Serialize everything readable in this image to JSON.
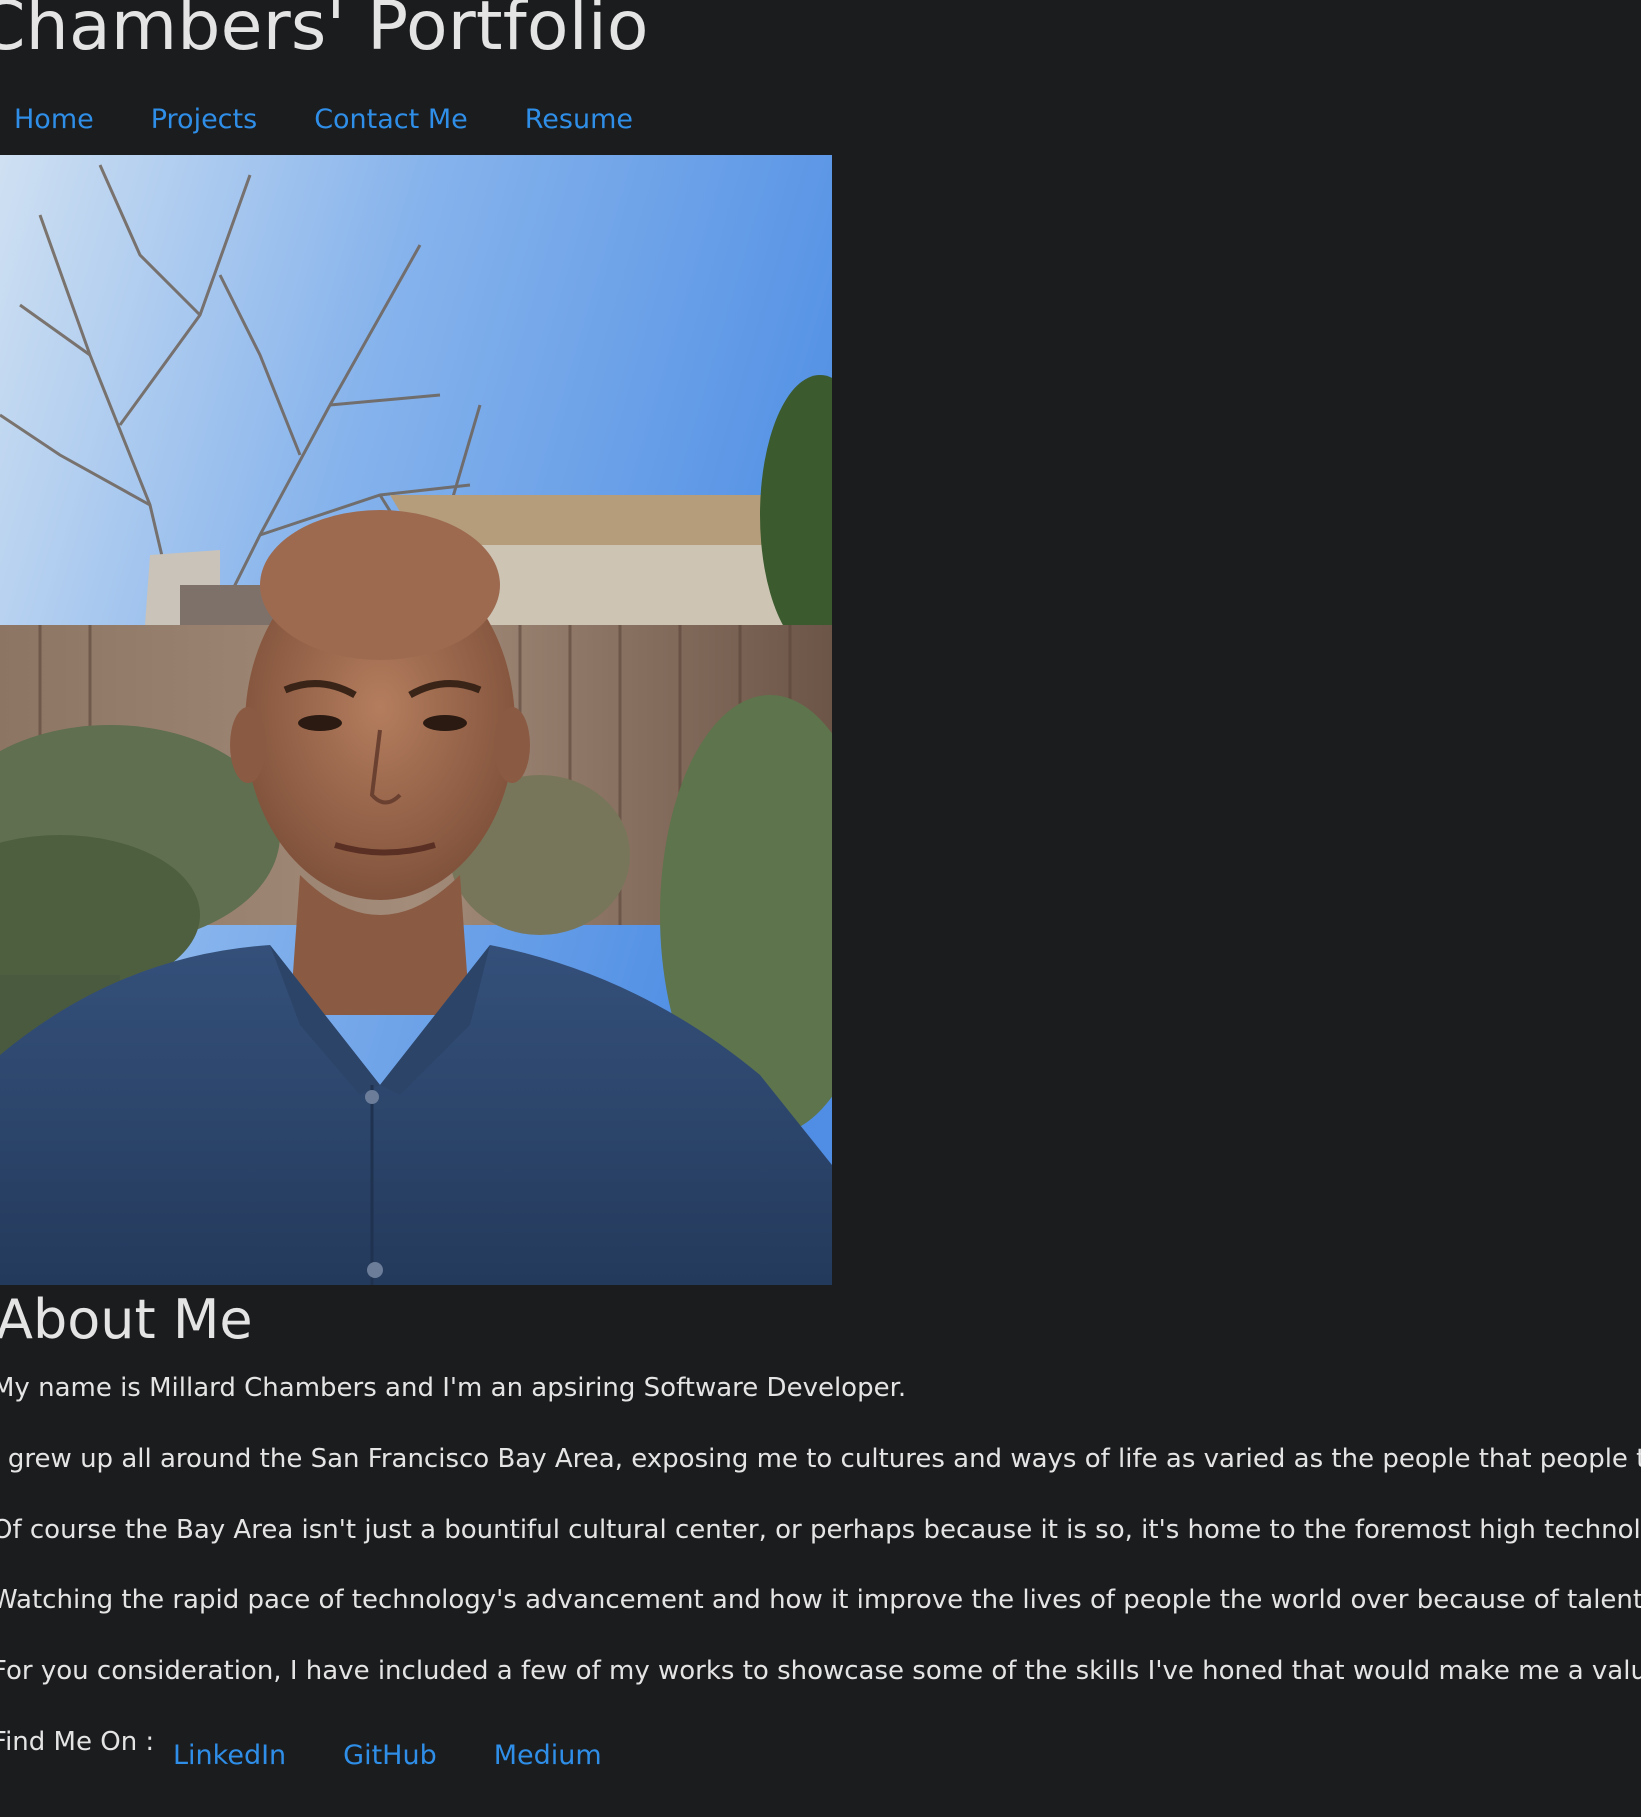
{
  "header": {
    "title": "Chambers' Portfolio"
  },
  "nav": {
    "items": [
      "Home",
      "Projects",
      "Contact Me",
      "Resume"
    ]
  },
  "about": {
    "heading": "About Me",
    "paragraphs": [
      "My name is Millard Chambers and I'm an apsiring Software Developer.",
      "I grew up all around the San Francisco Bay Area, exposing me to cultures and ways of life as varied as the people that people that mal",
      "Of course the Bay Area isn't just a bountiful cultural center, or perhaps because it is so, it's home to the foremost high technology hub",
      "Watching the rapid pace of technology's advancement and how it improve the lives of people the world over because of talented and",
      "For you consideration, I have included a few of my works to showcase some of the skills I've honed that would make me a valuable m"
    ]
  },
  "social": {
    "label": "Find Me On :",
    "links": [
      "LinkedIn",
      "GitHub",
      "Medium"
    ]
  },
  "colors": {
    "background": "#1b1c1e",
    "text": "#e4e4e4",
    "link": "#2f8ee8"
  }
}
